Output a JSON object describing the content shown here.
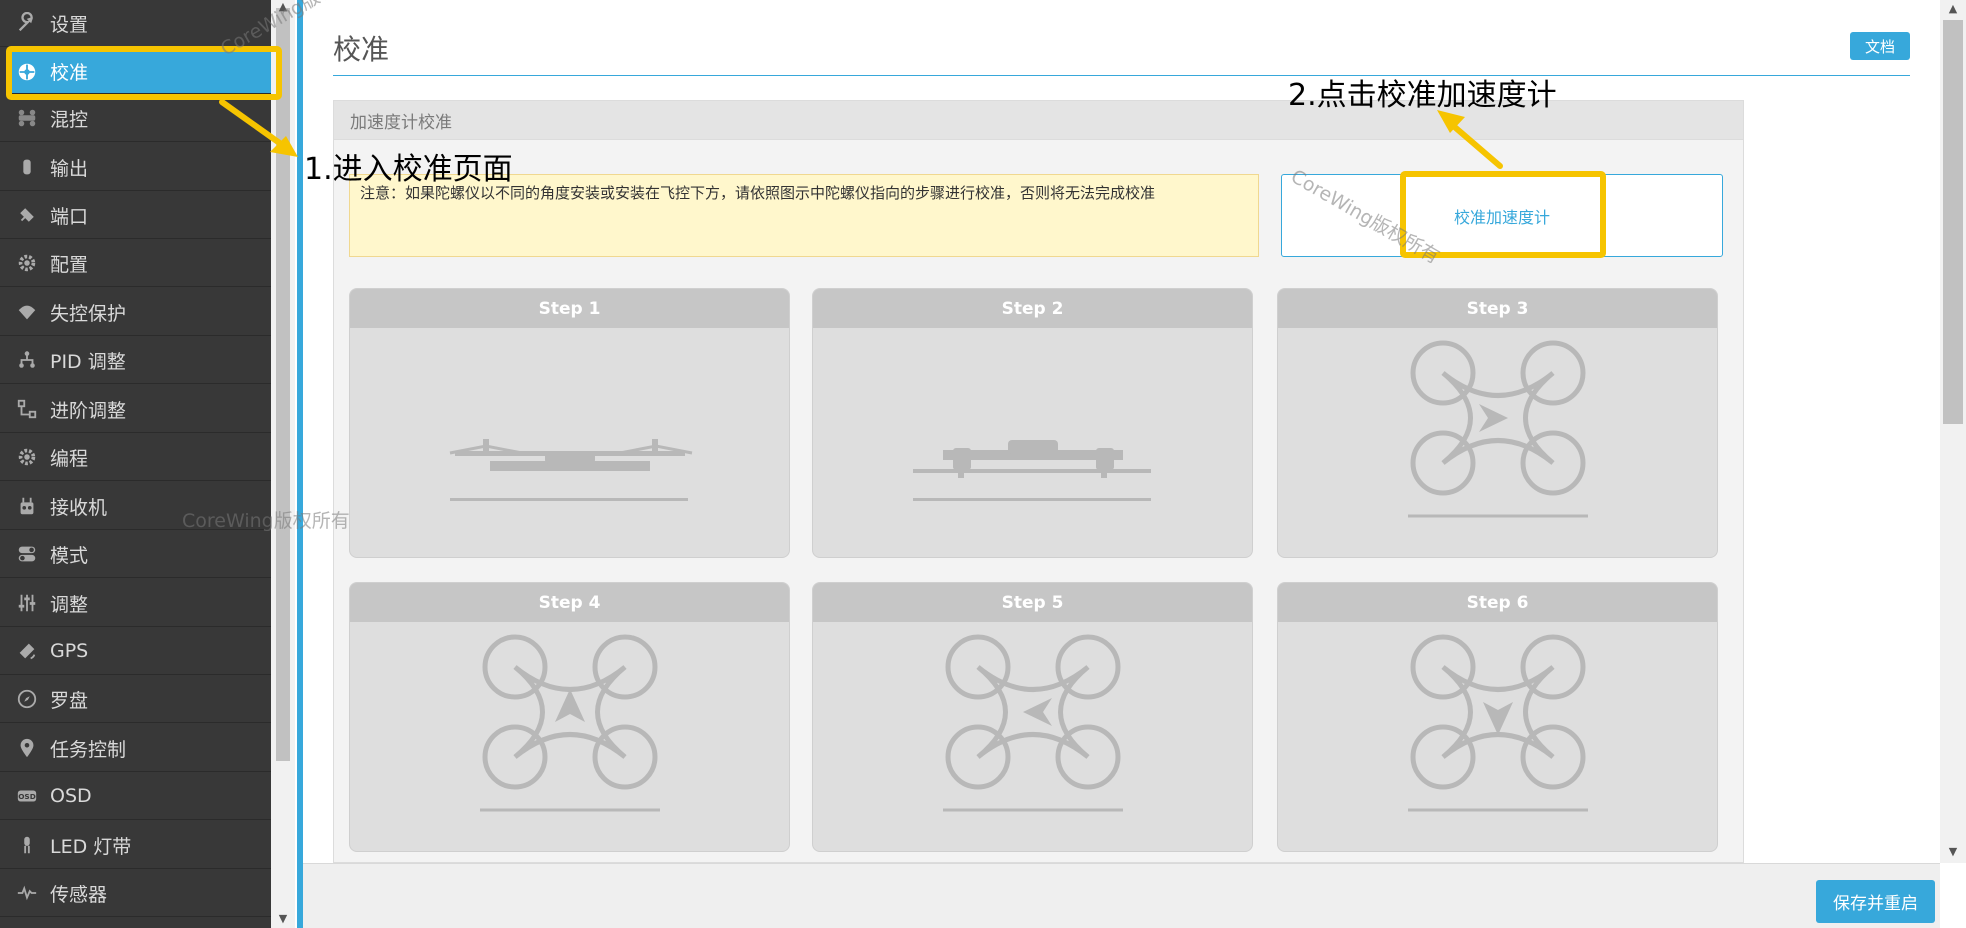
{
  "sidebar": {
    "items": [
      {
        "label": "设置",
        "icon": "wrench-icon"
      },
      {
        "label": "校准",
        "icon": "crosshair-icon"
      },
      {
        "label": "混控",
        "icon": "mixer-icon"
      },
      {
        "label": "输出",
        "icon": "motor-icon"
      },
      {
        "label": "端口",
        "icon": "plug-icon"
      },
      {
        "label": "配置",
        "icon": "gear-icon"
      },
      {
        "label": "失控保护",
        "icon": "parachute-icon"
      },
      {
        "label": "PID 调整",
        "icon": "tree-icon"
      },
      {
        "label": "进阶调整",
        "icon": "flow-icon"
      },
      {
        "label": "编程",
        "icon": "gear-icon"
      },
      {
        "label": "接收机",
        "icon": "remote-icon"
      },
      {
        "label": "模式",
        "icon": "toggle-icon"
      },
      {
        "label": "调整",
        "icon": "sliders-icon"
      },
      {
        "label": "GPS",
        "icon": "satellite-icon"
      },
      {
        "label": "罗盘",
        "icon": "compass-icon"
      },
      {
        "label": "任务控制",
        "icon": "map-pin-icon"
      },
      {
        "label": "OSD",
        "icon": "osd-icon"
      },
      {
        "label": "LED 灯带",
        "icon": "led-icon"
      },
      {
        "label": "传感器",
        "icon": "pulse-icon"
      }
    ],
    "active_index": 1
  },
  "page": {
    "title": "校准",
    "wiki_label": "文档",
    "panel_title": "加速度计校准",
    "note": "注意：如果陀螺仪以不同的角度安装或安装在飞控下方，请依照图示中陀螺仪指向的步骤进行校准，否则将无法完成校准",
    "calibrate_button": "校准加速度计",
    "steps": [
      {
        "label": "Step 1",
        "pose": "level"
      },
      {
        "label": "Step 2",
        "pose": "inverted"
      },
      {
        "label": "Step 3",
        "pose": "arrow-right"
      },
      {
        "label": "Step 4",
        "pose": "arrow-up"
      },
      {
        "label": "Step 5",
        "pose": "arrow-left"
      },
      {
        "label": "Step 6",
        "pose": "arrow-down"
      }
    ]
  },
  "footer": {
    "save_label": "保存并重启"
  },
  "annotations": {
    "step1": "1.进入校准页面",
    "step2": "2.点击校准加速度计",
    "watermark": "CoreWing版权所有",
    "highlight_color": "#f6c400"
  },
  "colors": {
    "accent": "#37a8db",
    "sidebar_bg": "#383838"
  }
}
